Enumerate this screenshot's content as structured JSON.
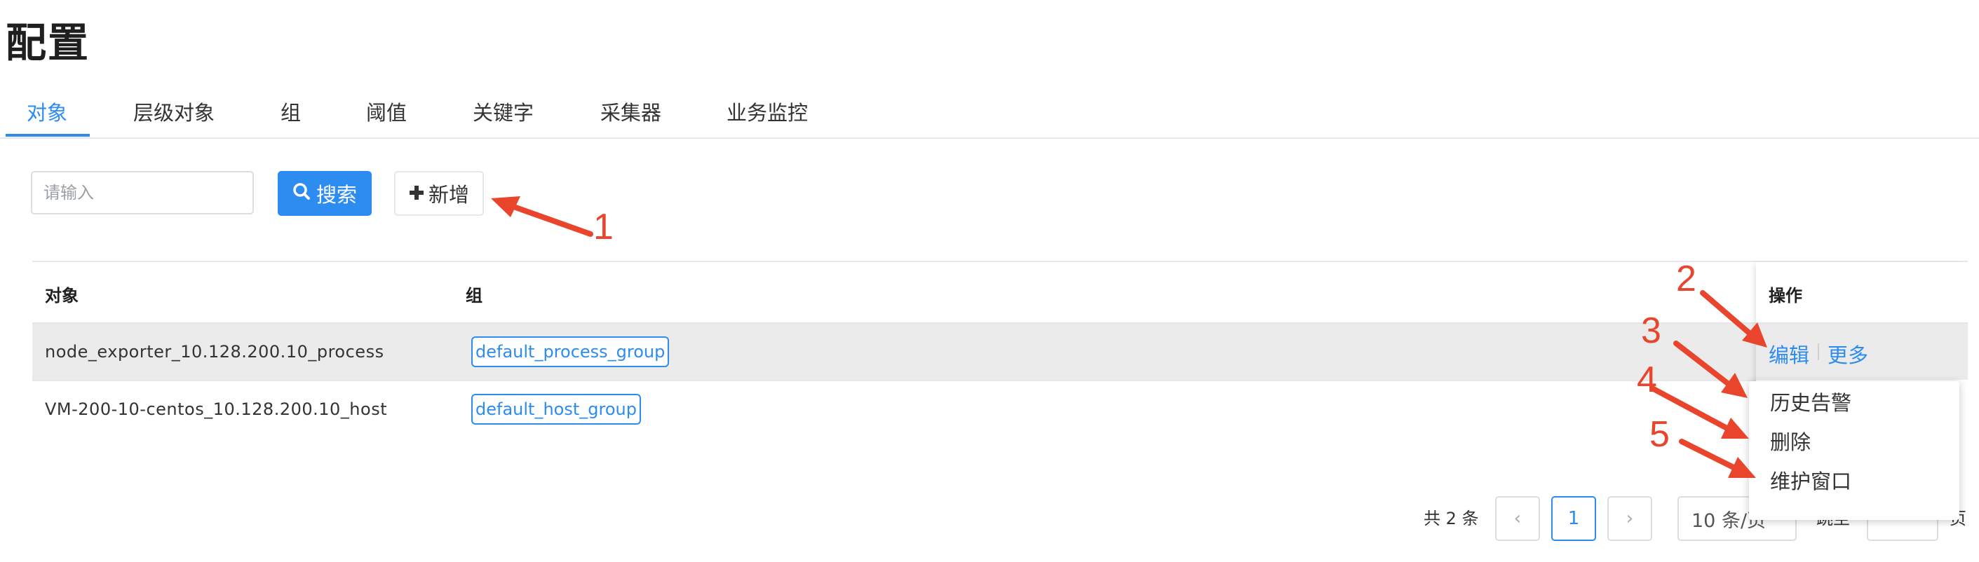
{
  "page": {
    "title": "配置"
  },
  "tabs": [
    "对象",
    "层级对象",
    "组",
    "阈值",
    "关键字",
    "采集器",
    "业务监控"
  ],
  "search": {
    "placeholder": "请输入",
    "button_label": "搜索"
  },
  "add_button_label": "新增",
  "table": {
    "columns": {
      "object": "对象",
      "group": "组",
      "actions": "操作"
    },
    "rows": [
      {
        "object": "node_exporter_10.128.200.10_process",
        "group": "default_process_group"
      },
      {
        "object": "VM-200-10-centos_10.128.200.10_host",
        "group": "default_host_group"
      }
    ],
    "actions": {
      "edit": "编辑",
      "more": "更多"
    }
  },
  "more_menu": [
    "历史告警",
    "删除",
    "维护窗口"
  ],
  "pagination": {
    "total": "共 2 条",
    "current_page": "1",
    "page_size": "10 条/页",
    "jump_prefix": "跳至",
    "jump_suffix": "页",
    "prev_icon": "‹",
    "next_icon": "›"
  },
  "annotations": [
    "1",
    "2",
    "3",
    "4",
    "5"
  ],
  "colors": {
    "primary": "#2d8cf0",
    "annotation": "#e8452c"
  },
  "icons": {
    "search": "search-icon",
    "add": "plus-icon",
    "arrow": "arrow-icon"
  }
}
